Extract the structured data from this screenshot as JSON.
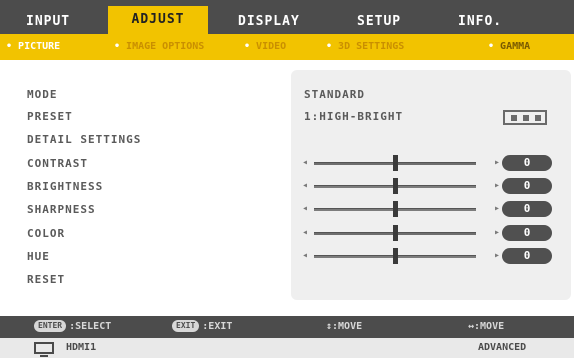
{
  "tabs": [
    {
      "label": "INPUT",
      "active": false
    },
    {
      "label": "ADJUST",
      "active": true
    },
    {
      "label": "DISPLAY",
      "active": false
    },
    {
      "label": "SETUP",
      "active": false
    },
    {
      "label": "INFO.",
      "active": false
    }
  ],
  "subtabs": [
    {
      "label": "PICTURE",
      "active": true
    },
    {
      "label": "IMAGE OPTIONS",
      "active": false
    },
    {
      "label": "VIDEO",
      "active": false
    },
    {
      "label": "3D SETTINGS",
      "active": false
    },
    {
      "label": "GAMMA",
      "active": false
    }
  ],
  "rows": {
    "mode": {
      "label": "MODE",
      "value": "STANDARD"
    },
    "preset": {
      "label": "PRESET",
      "value": "1:HIGH-BRIGHT"
    },
    "detail": {
      "label": "DETAIL SETTINGS"
    },
    "contrast": {
      "label": "CONTRAST",
      "value": "0",
      "level": 0.5
    },
    "brightness": {
      "label": "BRIGHTNESS",
      "value": "0",
      "level": 0.5
    },
    "sharpness": {
      "label": "SHARPNESS",
      "value": "0",
      "level": 0.5
    },
    "color": {
      "label": "COLOR",
      "value": "0",
      "level": 0.5
    },
    "hue": {
      "label": "HUE",
      "value": "0",
      "level": 0.5
    },
    "reset": {
      "label": "RESET"
    }
  },
  "help": {
    "select_key": "ENTER",
    "select_label": "SELECT",
    "exit_key": "EXIT",
    "exit_label": "EXIT",
    "move_ud": "↕:MOVE",
    "move_lr": "↔:MOVE"
  },
  "status": {
    "source": "HDMI1",
    "level": "ADVANCED"
  },
  "colors": {
    "accent": "#f2c300",
    "bar": "#4c4c4c",
    "badge": "#505050"
  }
}
